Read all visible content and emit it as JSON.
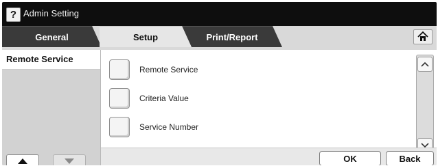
{
  "window": {
    "title": "Admin Setting",
    "help_label": "?"
  },
  "tabs": [
    {
      "label": "General",
      "active": false
    },
    {
      "label": "Setup",
      "active": true
    },
    {
      "label": "Print/Report",
      "active": false
    }
  ],
  "home_button": {
    "icon": "home-icon"
  },
  "left_panel": {
    "title": "Remote Service",
    "up_icon": "triangle-up-icon",
    "down_icon": "triangle-down-icon"
  },
  "options": [
    {
      "label": "Remote Service"
    },
    {
      "label": "Criteria Value"
    },
    {
      "label": "Service Number"
    }
  ],
  "scrollbar": {
    "up_icon": "chevron-up-icon",
    "down_icon": "chevron-down-icon"
  },
  "actions": {
    "ok_label": "OK",
    "back_label": "Back"
  },
  "colors": {
    "title_bar": "#0e0e0e",
    "inactive_tab": "#3a3a3a",
    "active_tab": "#e6e6e6"
  }
}
